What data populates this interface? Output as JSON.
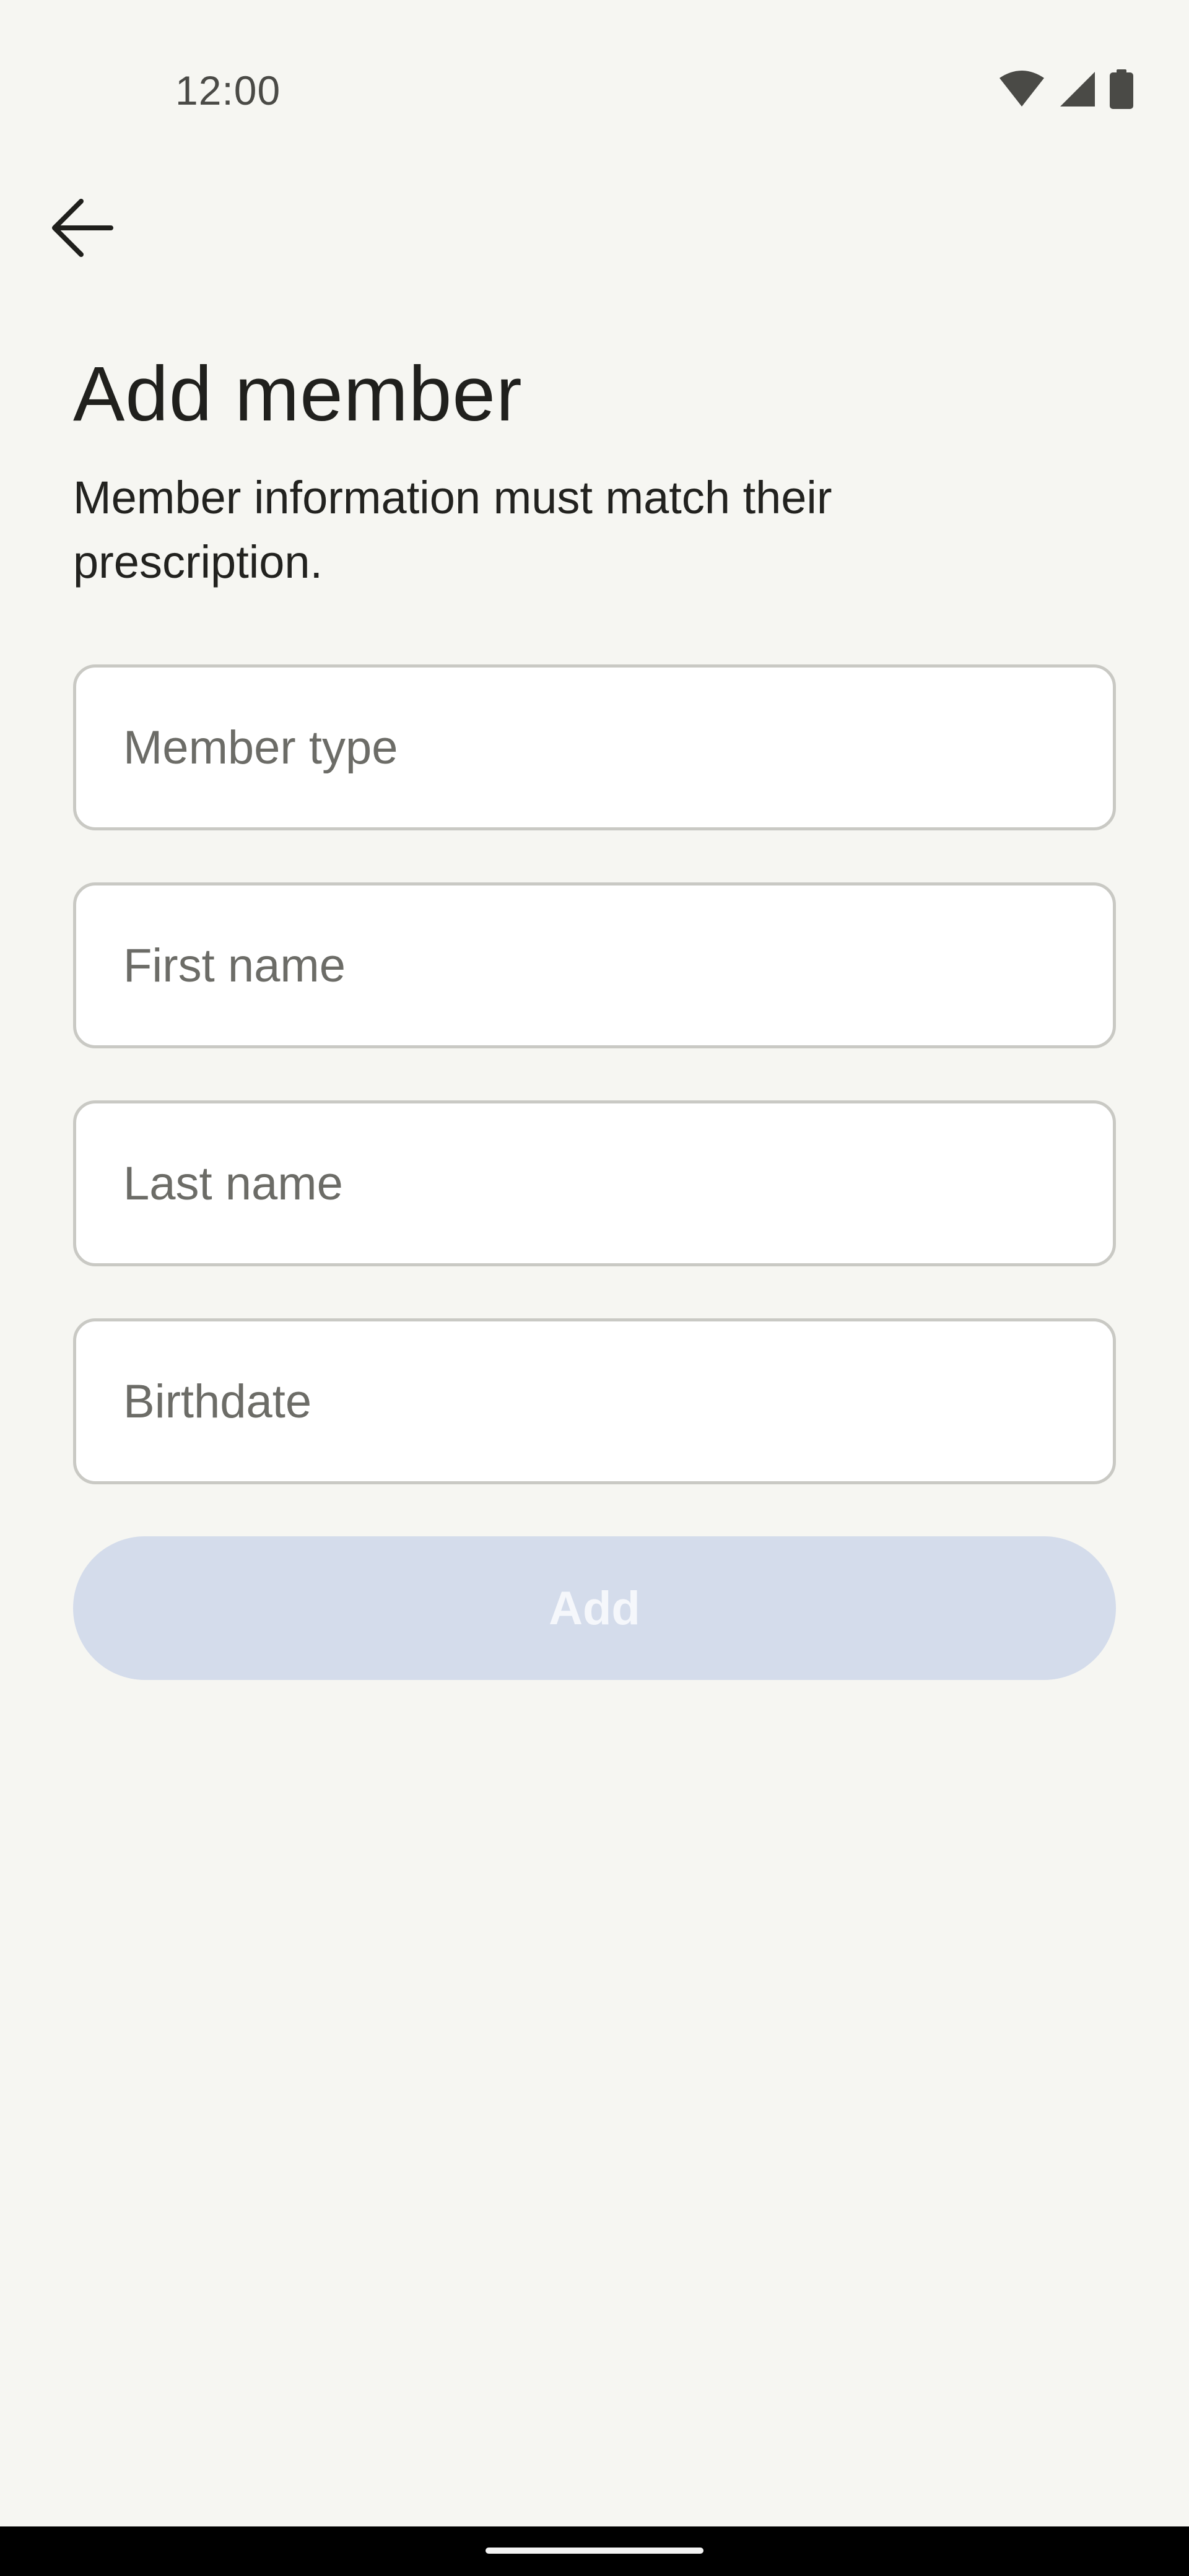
{
  "status_bar": {
    "time": "12:00",
    "icons": [
      "wifi-icon",
      "cellular-signal-icon",
      "battery-icon"
    ]
  },
  "header": {
    "back_icon": "arrow-left-icon",
    "title": "Add member",
    "subtitle": "Member information must match their prescription."
  },
  "form": {
    "fields": [
      {
        "placeholder": "Member type",
        "value": ""
      },
      {
        "placeholder": "First name",
        "value": ""
      },
      {
        "placeholder": "Last name",
        "value": ""
      },
      {
        "placeholder": "Birthdate",
        "value": ""
      }
    ],
    "submit_label": "Add",
    "submit_enabled": false
  },
  "colors": {
    "background": "#f6f6f2",
    "field_border": "#c9c9c4",
    "button_disabled_bg": "#d4dceb",
    "button_disabled_text": "#f5f7fb",
    "text_primary": "#20201d",
    "placeholder": "#6c6c67"
  }
}
